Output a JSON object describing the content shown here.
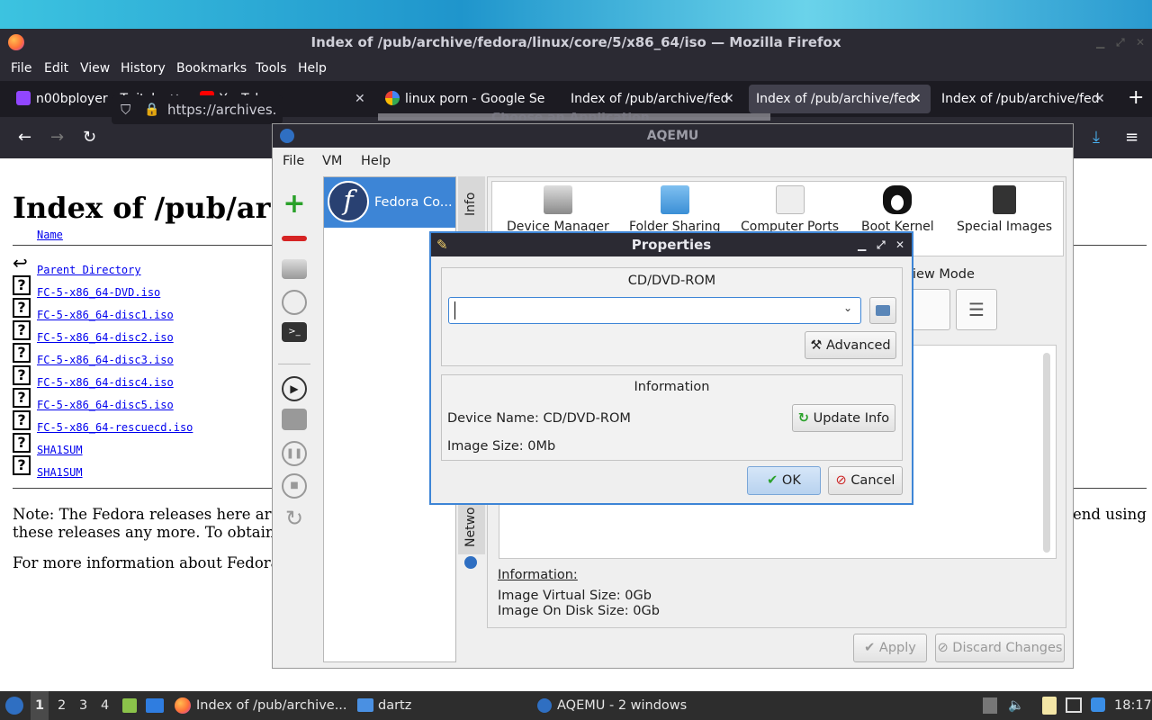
{
  "firefox": {
    "window_title": "Index of /pub/archive/fedora/linux/core/5/x86_64/iso — Mozilla Firefox",
    "menu": [
      "File",
      "Edit",
      "View",
      "History",
      "Bookmarks",
      "Tools",
      "Help"
    ],
    "tabs": [
      {
        "label": "n00bployer - Twitch",
        "icon": "twitch-icon"
      },
      {
        "label": "YouTube",
        "icon": "youtube-icon"
      },
      {
        "label": "linux porn - Google Se",
        "icon": "google-icon"
      },
      {
        "label": "Index of /pub/archive/fed",
        "icon": ""
      },
      {
        "label": "Index of /pub/archive/fed",
        "icon": "",
        "active": true
      },
      {
        "label": "Index of /pub/archive/fed",
        "icon": ""
      }
    ],
    "url": "https://archives.",
    "ghost_dialog_title": "Choose an Application"
  },
  "page": {
    "heading": "Index of /pub/ar",
    "name_col": "Name",
    "files": [
      "Parent Directory",
      "FC-5-x86_64-DVD.iso",
      "FC-5-x86_64-disc1.iso",
      "FC-5-x86_64-disc2.iso",
      "FC-5-x86_64-disc3.iso",
      "FC-5-x86_64-disc4.iso",
      "FC-5-x86_64-disc5.iso",
      "FC-5-x86_64-rescuecd.iso",
      "SHA1SUM"
    ],
    "note_line1": "Note: The Fedora releases here are",
    "note_line2": "these releases any more. To obtain",
    "note_right": "end using",
    "more_info": "For more information about Fedora"
  },
  "aqemu": {
    "title": "AQEMU",
    "menu": [
      "File",
      "VM",
      "Help"
    ],
    "vm_name": "Fedora Co...",
    "side_tabs": {
      "info": "Info",
      "network": "Netwo"
    },
    "icons": [
      "Device Manager",
      "Folder Sharing",
      "Computer Ports",
      "Boot Kernel",
      "Special Images"
    ],
    "view_mode": "iew Mode",
    "info_label": "Information:",
    "virtual_size": "Image Virtual Size: 0Gb",
    "disk_size": "Image On Disk Size: 0Gb",
    "apply": "Apply",
    "discard": "Discard Changes"
  },
  "dialog": {
    "title": "Properties",
    "cdrom_group": "CD/DVD-ROM",
    "path_value": "",
    "advanced": "Advanced",
    "info_group": "Information",
    "device_name": "Device Name: CD/DVD-ROM",
    "image_size": "Image Size: 0Mb",
    "update_info": "Update Info",
    "ok": "OK",
    "cancel": "Cancel"
  },
  "taskbar": {
    "workspaces": [
      "1",
      "2",
      "3",
      "4"
    ],
    "tasks": [
      "Index of /pub/archive...",
      "dartz",
      "AQEMU - 2 windows"
    ],
    "clock": "18:17"
  }
}
